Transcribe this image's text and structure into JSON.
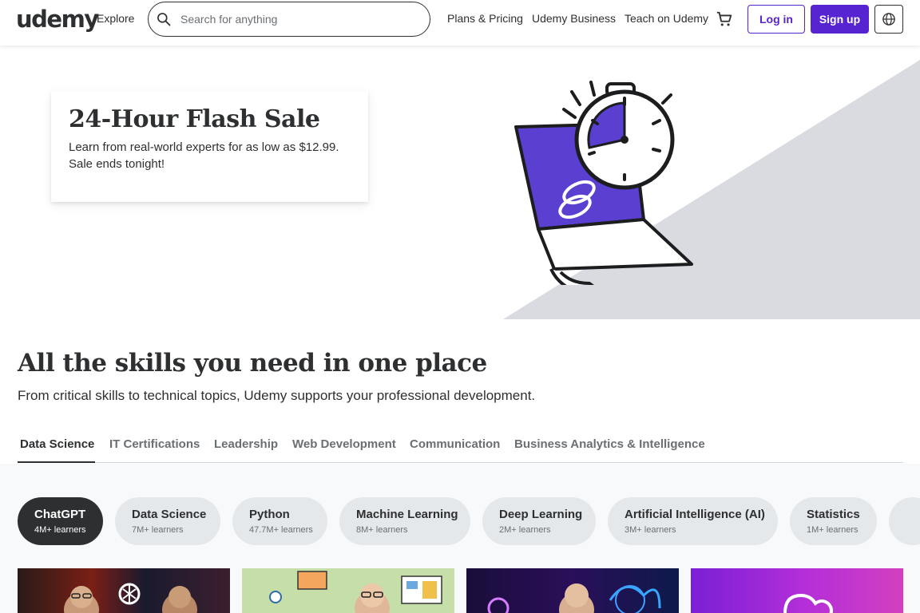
{
  "header": {
    "logo": "udemy",
    "explore_label": "Explore",
    "search": {
      "placeholder": "Search for anything",
      "value": ""
    },
    "nav": {
      "plans_pricing": "Plans & Pricing",
      "udemy_business": "Udemy Business",
      "teach": "Teach on Udemy"
    },
    "login_label": "Log in",
    "signup_label": "Sign up",
    "icons": {
      "search": "search-icon",
      "cart": "cart-icon",
      "language": "globe-icon"
    }
  },
  "hero": {
    "title": "24-Hour Flash Sale",
    "text_line1": "Learn from real-world experts for as low as $12.99.",
    "text_line2": "Sale ends tonight!"
  },
  "skills": {
    "title": "All the skills you need in one place",
    "subtitle": "From critical skills to technical topics, Udemy supports your professional development.",
    "tabs": [
      {
        "label": "Data Science",
        "active": true
      },
      {
        "label": "IT Certifications",
        "active": false
      },
      {
        "label": "Leadership",
        "active": false
      },
      {
        "label": "Web Development",
        "active": false
      },
      {
        "label": "Communication",
        "active": false
      },
      {
        "label": "Business Analytics & Intelligence",
        "active": false
      }
    ],
    "topics": [
      {
        "name": "ChatGPT",
        "learners": "4M+ learners",
        "active": true
      },
      {
        "name": "Data Science",
        "learners": "7M+ learners",
        "active": false
      },
      {
        "name": "Python",
        "learners": "47.7M+ learners",
        "active": false
      },
      {
        "name": "Machine Learning",
        "learners": "8M+ learners",
        "active": false
      },
      {
        "name": "Deep Learning",
        "learners": "2M+ learners",
        "active": false
      },
      {
        "name": "Artificial Intelligence (AI)",
        "learners": "3M+ learners",
        "active": false
      },
      {
        "name": "Statistics",
        "learners": "1M+ learners",
        "active": false
      }
    ]
  },
  "colors": {
    "brand_purple": "#5624d0",
    "illustration_purple": "#5b3fd1",
    "text_dark": "#2d2f31",
    "text_muted": "#6a6f73",
    "pill_bg": "#e4e8eb",
    "hero_triangle": "#d9dbe0"
  }
}
